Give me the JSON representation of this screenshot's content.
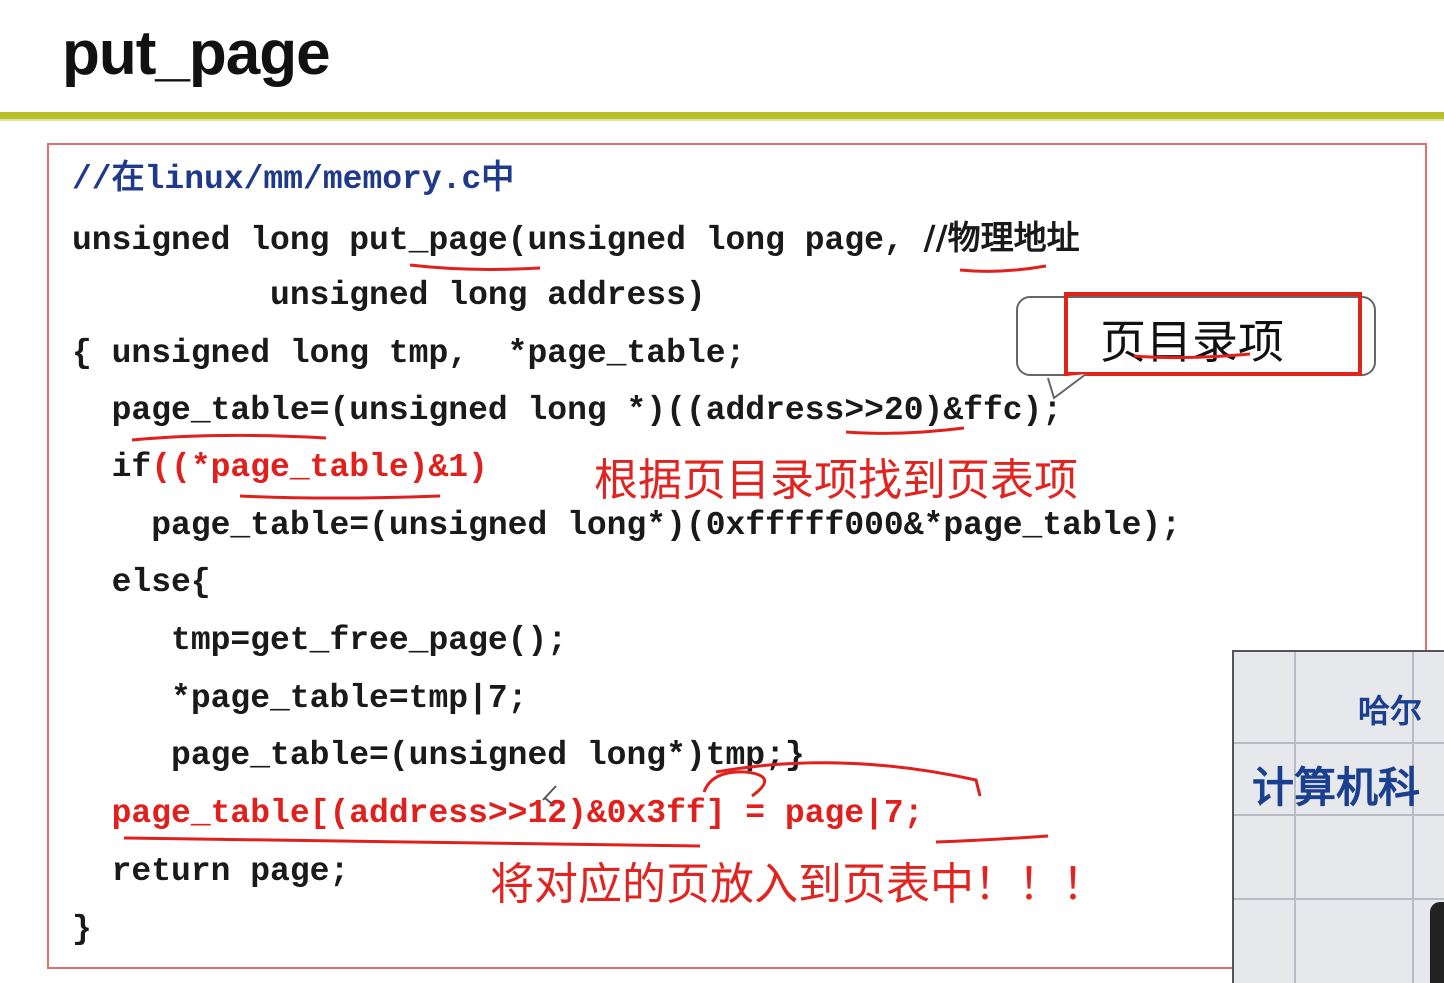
{
  "slide": {
    "title": "put_page"
  },
  "code": {
    "line1": "//在linux/mm/memory.c中",
    "line2a": "unsigned long put_page(unsigned long page, ",
    "line2b": "//物理地址",
    "line3": "          unsigned long address)",
    "line4": "{ unsigned long tmp,  *page_table;",
    "line5": "  page_table=(unsigned long *)((address>>20)&ffc);",
    "line6a": "  if",
    "line6b": "((*page_table)&1)",
    "line7": "    page_table=(unsigned long*)(0xfffff000&*page_table);",
    "line8": "  else{",
    "line9": "     tmp=get_free_page();",
    "line10": "     *page_table=tmp|7;",
    "line11": "     page_table=(unsigned long*)tmp;}",
    "line12": "  page_table[(address>>12)&0x3ff] = page|7;",
    "line13": "  return page;",
    "line14": "}"
  },
  "annotations": {
    "callout": "页目录项",
    "note1": "根据页目录项找到页表项",
    "note2": "将对应的页放入到页表中！！！"
  },
  "video": {
    "sign_line1": "哈尔",
    "sign_line2": "计算机科"
  },
  "colors": {
    "accent_rule": "#b9bf2a",
    "annotation_red": "#e0201c",
    "comment_blue": "#1f3a8a",
    "frame": "#e0706e"
  }
}
